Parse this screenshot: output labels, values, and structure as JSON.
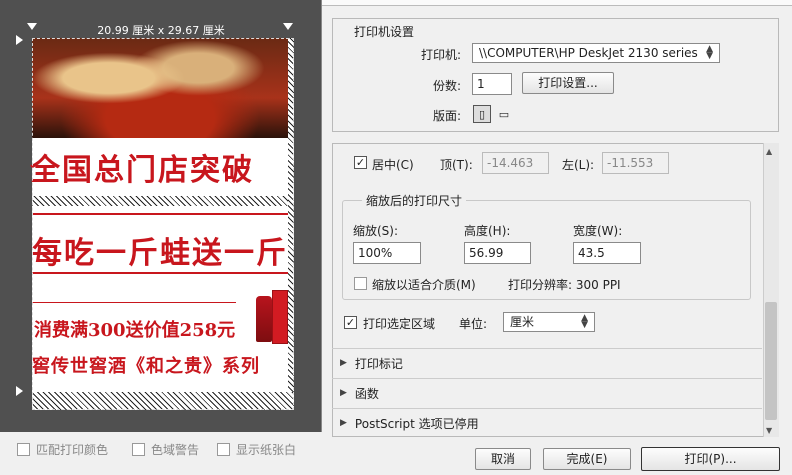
{
  "preview": {
    "dimension_label": "20.99 厘米 x 29.67 厘米",
    "ad_text_1": "全国总门店突破",
    "ad_text_2": "每吃一斤蛙送一斤",
    "ad_text_3": "消费满300送价值258元",
    "ad_text_4": "窖传世窖酒《和之贵》系列"
  },
  "bottom_options": {
    "match_color": "匹配打印颜色",
    "gamut_warning": "色域警告",
    "show_paper_white": "显示纸张白"
  },
  "printer_settings": {
    "title": "打印机设置",
    "printer_label": "打印机:",
    "printer_value": "\\\\COMPUTER\\HP DeskJet 2130 series",
    "copies_label": "份数:",
    "copies_value": "1",
    "print_settings_button": "打印设置...",
    "layout_label": "版面:"
  },
  "position": {
    "center_label": "居中(C)",
    "top_label": "顶(T):",
    "top_value": "-14.463",
    "left_label": "左(L):",
    "left_value": "-11.553"
  },
  "scaled_size": {
    "title": "缩放后的打印尺寸",
    "scale_label": "缩放(S):",
    "scale_value": "100%",
    "height_label": "高度(H):",
    "height_value": "56.99",
    "width_label": "宽度(W):",
    "width_value": "43.5",
    "fit_media_label": "缩放以适合介质(M)",
    "resolution_text": "打印分辨率: 300 PPI"
  },
  "selection": {
    "print_selected_area_label": "打印选定区域",
    "unit_label": "单位:",
    "unit_value": "厘米"
  },
  "sections": {
    "print_marks": "打印标记",
    "functions": "函数",
    "postscript": "PostScript 选项已停用"
  },
  "buttons": {
    "cancel": "取消",
    "done": "完成(E)",
    "print": "打印(P)..."
  }
}
